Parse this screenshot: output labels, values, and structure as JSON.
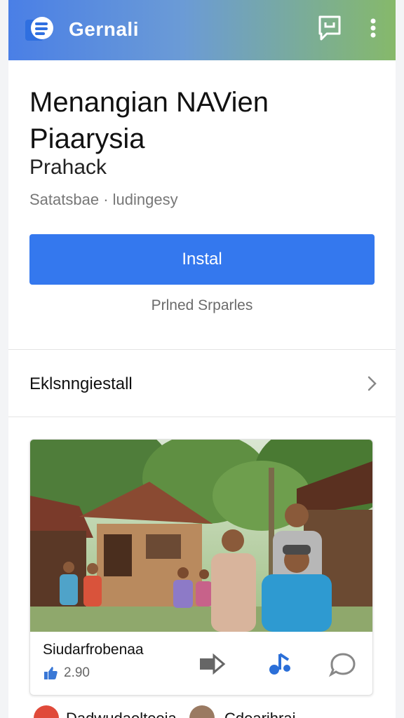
{
  "app": {
    "name": "Gernali"
  },
  "listing": {
    "title": "Menangian NAVien Piaarysia",
    "subtitle": "Prahack",
    "meta": "Satatsbae · ludingesy",
    "install_label": "Instal",
    "note": "Prlned Srparles"
  },
  "details_link": {
    "label": "Eklsnngiestall"
  },
  "post_card": {
    "title": "Siudarfrobenaa",
    "stat": "2.90"
  },
  "bottom_list": {
    "items": [
      {
        "label": "Dadwudaolteoia"
      },
      {
        "label": "Cdearihrai"
      }
    ]
  },
  "colors": {
    "accent": "#3478ee",
    "header_start": "#4a7fe6",
    "header_end": "#86b96a"
  }
}
